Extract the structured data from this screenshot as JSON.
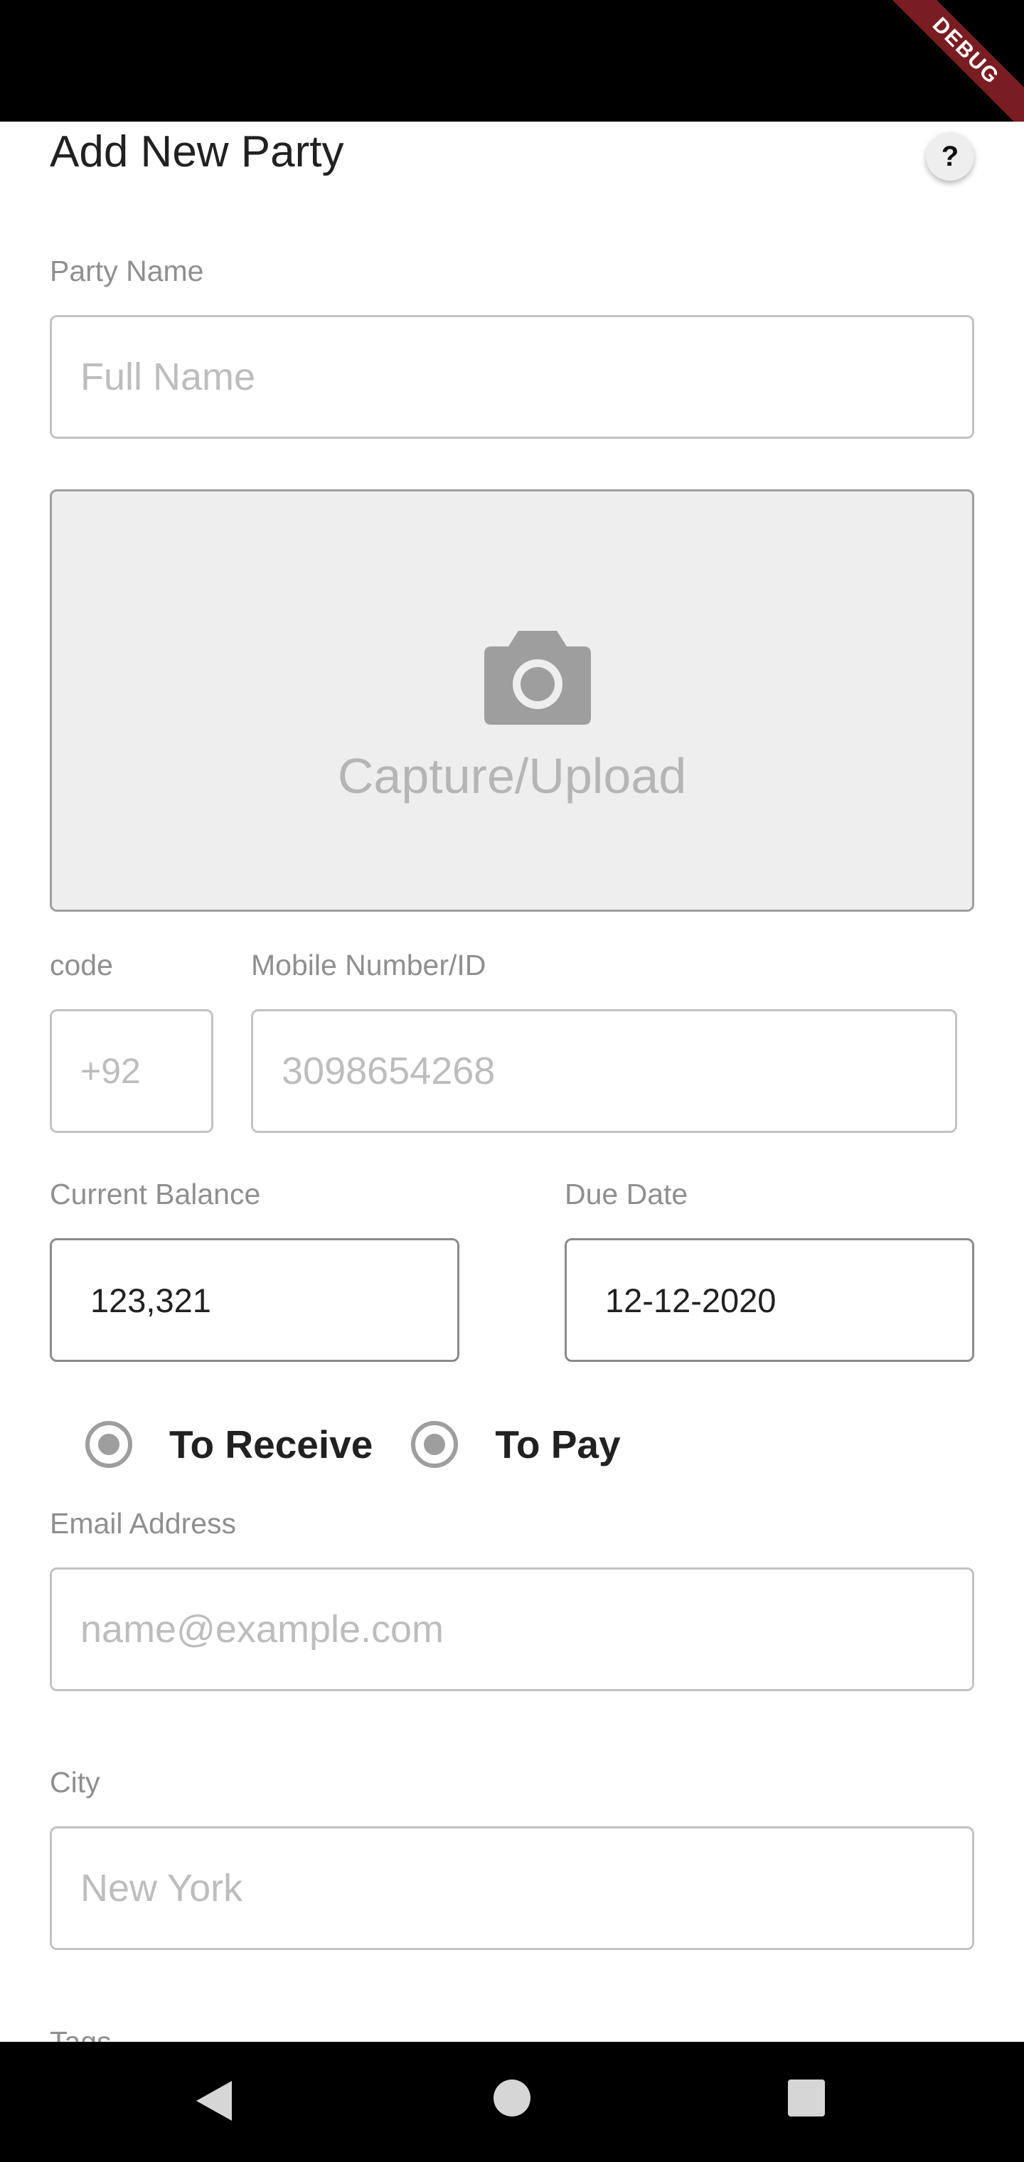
{
  "status_bar": {
    "debug_label": "DEBUG"
  },
  "header": {
    "title": "Add New Party",
    "help_label": "?"
  },
  "party_name": {
    "label": "Party Name",
    "placeholder": "Full Name"
  },
  "photo": {
    "label": "Capture/Upload",
    "icon": "camera-icon"
  },
  "phone": {
    "code_label": "code",
    "code_placeholder": "+92",
    "mobile_label": "Mobile Number/ID",
    "mobile_placeholder": "3098654268"
  },
  "balance": {
    "label": "Current Balance",
    "value": "123,321"
  },
  "due_date": {
    "label": "Due Date",
    "value": "12-12-2020"
  },
  "direction": {
    "options": [
      "To Receive",
      "To Pay"
    ]
  },
  "email": {
    "label": "Email Address",
    "placeholder": "name@example.com"
  },
  "city": {
    "label": "City",
    "placeholder": "New York"
  },
  "tags": {
    "label": "Tags"
  },
  "nav": {
    "back_icon": "back-triangle-icon",
    "home_icon": "home-circle-icon",
    "recents_icon": "recents-square-icon"
  },
  "colors": {
    "border": "#c3c3c3",
    "capture_bg": "#eeeeee",
    "debug_banner": "#7a1d22"
  }
}
